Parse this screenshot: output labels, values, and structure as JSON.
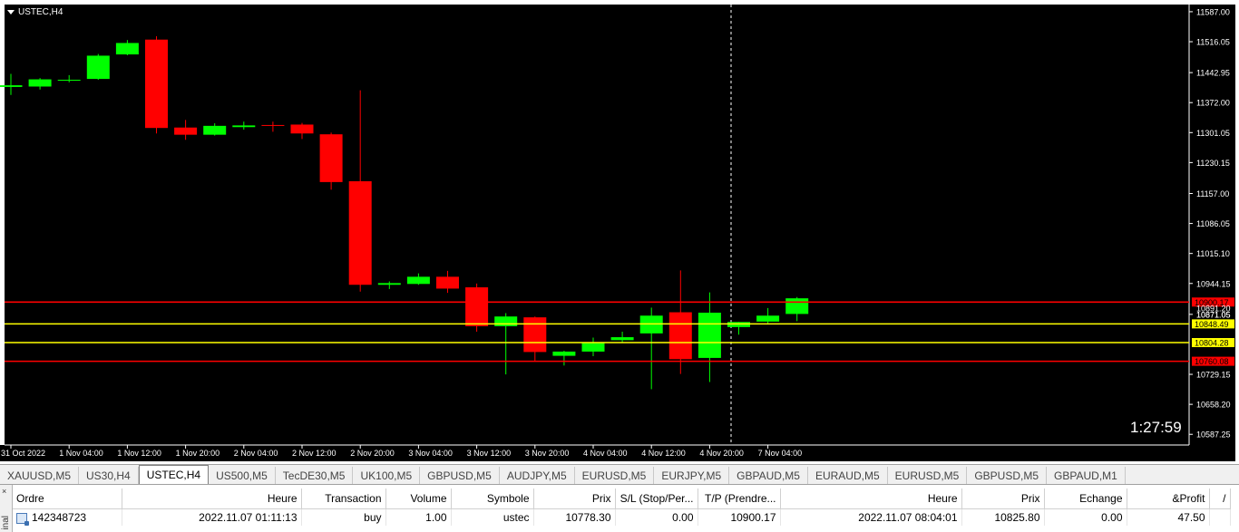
{
  "chart_title": "USTEC,H4",
  "countdown": "1:27:59",
  "colors": {
    "background": "#000000",
    "bull": "#00ff00",
    "bear": "#ff0000",
    "grid_text": "#ffffff",
    "stop_line": "#ff0000",
    "entry_line": "#ffff00"
  },
  "tabs": [
    {
      "label": "XAUUSD,M5",
      "active": false
    },
    {
      "label": "US30,H4",
      "active": false
    },
    {
      "label": "USTEC,H4",
      "active": true
    },
    {
      "label": "US500,M5",
      "active": false
    },
    {
      "label": "TecDE30,M5",
      "active": false
    },
    {
      "label": "UK100,M5",
      "active": false
    },
    {
      "label": "GBPUSD,M5",
      "active": false
    },
    {
      "label": "AUDJPY,M5",
      "active": false
    },
    {
      "label": "EURUSD,M5",
      "active": false
    },
    {
      "label": "EURJPY,M5",
      "active": false
    },
    {
      "label": "GBPAUD,M5",
      "active": false
    },
    {
      "label": "EURAUD,M5",
      "active": false
    },
    {
      "label": "EURUSD,M5",
      "active": false
    },
    {
      "label": "GBPUSD,M5",
      "active": false
    },
    {
      "label": "GBPAUD,M1",
      "active": false
    }
  ],
  "terminal": {
    "side_label": "inal",
    "close_symbol": "×",
    "columns": [
      "Ordre",
      "Heure",
      "Transaction",
      "Volume",
      "Symbole",
      "Prix",
      "S/L (Stop/Per...",
      "T/P (Prendre...",
      "Heure",
      "Prix",
      "Echange",
      "&Profit",
      "/"
    ],
    "rows": [
      {
        "ordre": "142348723",
        "heure": "2022.11.07 01:11:13",
        "transaction": "buy",
        "volume": "1.00",
        "symbole": "ustec",
        "prix": "10778.30",
        "sl": "0.00",
        "tp": "10900.17",
        "heure2": "2022.11.07 08:04:01",
        "prix2": "10825.80",
        "echange": "0.00",
        "profit": "47.50"
      }
    ]
  },
  "chart_data": {
    "type": "candlestick",
    "title": "USTEC,H4",
    "ylim": [
      10562,
      11604
    ],
    "y_ticks": [
      "11587.00",
      "11516.05",
      "11442.95",
      "11372.00",
      "11301.05",
      "11230.15",
      "11157.00",
      "11086.05",
      "11015.10",
      "10944.15",
      "10871.05",
      "10729.15",
      "10658.20",
      "10587.25"
    ],
    "x_ticks": [
      "31 Oct 2022",
      "1 Nov 04:00",
      "1 Nov 12:00",
      "1 Nov 20:00",
      "2 Nov 04:00",
      "2 Nov 12:00",
      "2 Nov 20:00",
      "3 Nov 04:00",
      "3 Nov 12:00",
      "3 Nov 20:00",
      "4 Nov 04:00",
      "4 Nov 12:00",
      "4 Nov 20:00",
      "7 Nov 04:00"
    ],
    "candles": [
      {
        "o": 11409,
        "h": 11440,
        "l": 11390,
        "c": 11413
      },
      {
        "o": 11410,
        "h": 11430,
        "l": 11403,
        "c": 11427
      },
      {
        "o": 11424,
        "h": 11437,
        "l": 11420,
        "c": 11426
      },
      {
        "o": 11428,
        "h": 11487,
        "l": 11426,
        "c": 11483
      },
      {
        "o": 11486,
        "h": 11520,
        "l": 11484,
        "c": 11513
      },
      {
        "o": 11521,
        "h": 11529,
        "l": 11299,
        "c": 11312
      },
      {
        "o": 11313,
        "h": 11331,
        "l": 11284,
        "c": 11296
      },
      {
        "o": 11296,
        "h": 11323,
        "l": 11294,
        "c": 11317
      },
      {
        "o": 11314,
        "h": 11327,
        "l": 11308,
        "c": 11318
      },
      {
        "o": 11319,
        "h": 11327,
        "l": 11303,
        "c": 11318
      },
      {
        "o": 11320,
        "h": 11324,
        "l": 11286,
        "c": 11299
      },
      {
        "o": 11297,
        "h": 11301,
        "l": 11166,
        "c": 11184
      },
      {
        "o": 11186,
        "h": 11401,
        "l": 10925,
        "c": 10941
      },
      {
        "o": 10941,
        "h": 10949,
        "l": 10931,
        "c": 10945
      },
      {
        "o": 10943,
        "h": 10968,
        "l": 10941,
        "c": 10960
      },
      {
        "o": 10960,
        "h": 10974,
        "l": 10922,
        "c": 10932
      },
      {
        "o": 10935,
        "h": 10944,
        "l": 10830,
        "c": 10843
      },
      {
        "o": 10843,
        "h": 10874,
        "l": 10729,
        "c": 10866
      },
      {
        "o": 10864,
        "h": 10866,
        "l": 10761,
        "c": 10782
      },
      {
        "o": 10773,
        "h": 10785,
        "l": 10750,
        "c": 10783
      },
      {
        "o": 10783,
        "h": 10816,
        "l": 10772,
        "c": 10805
      },
      {
        "o": 10810,
        "h": 10830,
        "l": 10804,
        "c": 10817
      },
      {
        "o": 10826,
        "h": 10887,
        "l": 10694,
        "c": 10868
      },
      {
        "o": 10876,
        "h": 10975,
        "l": 10730,
        "c": 10765
      },
      {
        "o": 10768,
        "h": 10923,
        "l": 10711,
        "c": 10875
      },
      {
        "o": 10841,
        "h": 10853,
        "l": 10823,
        "c": 10853
      },
      {
        "o": 10854,
        "h": 10886,
        "l": 10848,
        "c": 10868
      },
      {
        "o": 10872,
        "h": 10912,
        "l": 10855,
        "c": 10909
      }
    ],
    "price_lines": [
      {
        "value": 10900.17,
        "label": "10900.17",
        "color": "#ff0000"
      },
      {
        "value": 10848.49,
        "label": "10848.49",
        "color": "#ffff00"
      },
      {
        "value": 10804.28,
        "label": "10804.28",
        "color": "#ffff00"
      },
      {
        "value": 10760.08,
        "label": "10760.08",
        "color": "#ff0000"
      }
    ],
    "current_price_labels": [
      "10891.20",
      "10871.05"
    ],
    "grid": false
  }
}
